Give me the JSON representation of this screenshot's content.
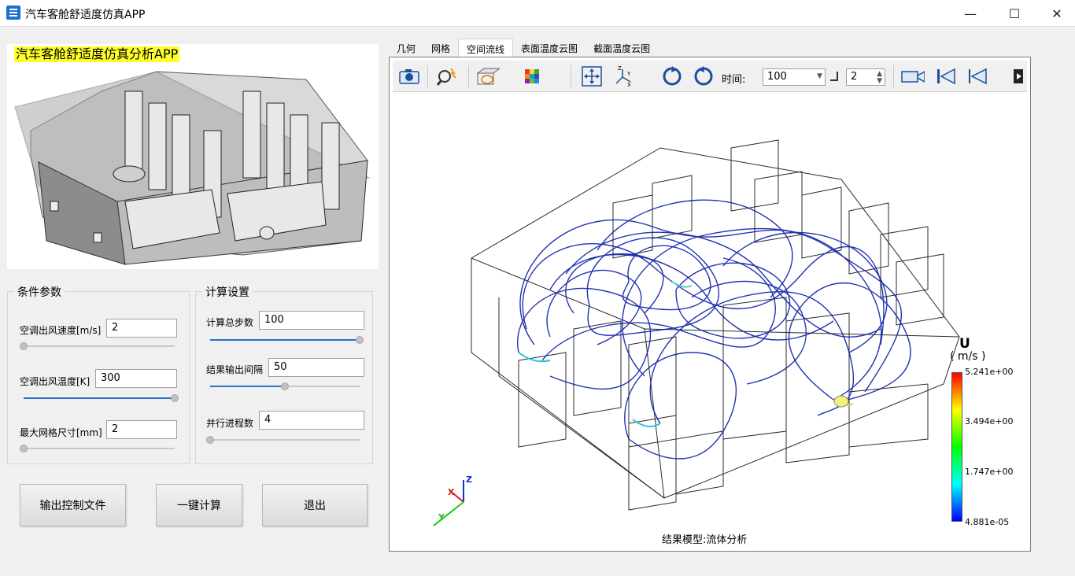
{
  "window": {
    "title": "汽车客舱舒适度仿真APP",
    "minimize": "—",
    "maximize": "☐",
    "close": "✕"
  },
  "hero": {
    "title": "汽车客舱舒适度仿真分析APP"
  },
  "conditions": {
    "title": "条件参数",
    "fields": [
      {
        "label": "空调出风速度[m/s]",
        "value": "2",
        "slider": 0.0
      },
      {
        "label": "空调出风温度[K]",
        "value": "300",
        "slider": 1.0
      },
      {
        "label": "最大网格尺寸[mm]",
        "value": "2",
        "slider": 0.0
      }
    ]
  },
  "compute": {
    "title": "计算设置",
    "fields": [
      {
        "label": "计算总步数",
        "value": "100",
        "slider": 1.0
      },
      {
        "label": "结果输出间隔",
        "value": "50",
        "slider": 0.5
      },
      {
        "label": "并行进程数",
        "value": "4",
        "slider": 0.0
      }
    ]
  },
  "buttons": {
    "export": "输出控制文件",
    "run": "一键计算",
    "exit": "退出"
  },
  "tabs": [
    {
      "label": "几何",
      "active": false
    },
    {
      "label": "网格",
      "active": false
    },
    {
      "label": "空间流线",
      "active": true
    },
    {
      "label": "表面温度云图",
      "active": false
    },
    {
      "label": "截面温度云图",
      "active": false
    }
  ],
  "toolbar": {
    "icons": [
      "camera-icon",
      "search-icon",
      "plane-icon",
      "colormap-icon",
      "fit-view-icon",
      "axes-icon",
      "rotate-left-icon",
      "rotate-right-icon",
      "video-icon",
      "first-frame-icon",
      "prev-frame-icon",
      "next-frame-icon"
    ],
    "time_label": "时间:",
    "time_value": "100",
    "step_value": "2"
  },
  "legend": {
    "variable": "U",
    "unit": "( m/s )",
    "ticks": [
      "5.241e+00",
      "3.494e+00",
      "1.747e+00",
      "4.881e-05"
    ],
    "colors": [
      "#ff0000",
      "#ffff00",
      "#00ff00",
      "#00ffff",
      "#0000ff"
    ]
  },
  "axes": {
    "x": "X",
    "y": "Y",
    "z": "Z"
  },
  "caption": "结果模型:流体分析"
}
